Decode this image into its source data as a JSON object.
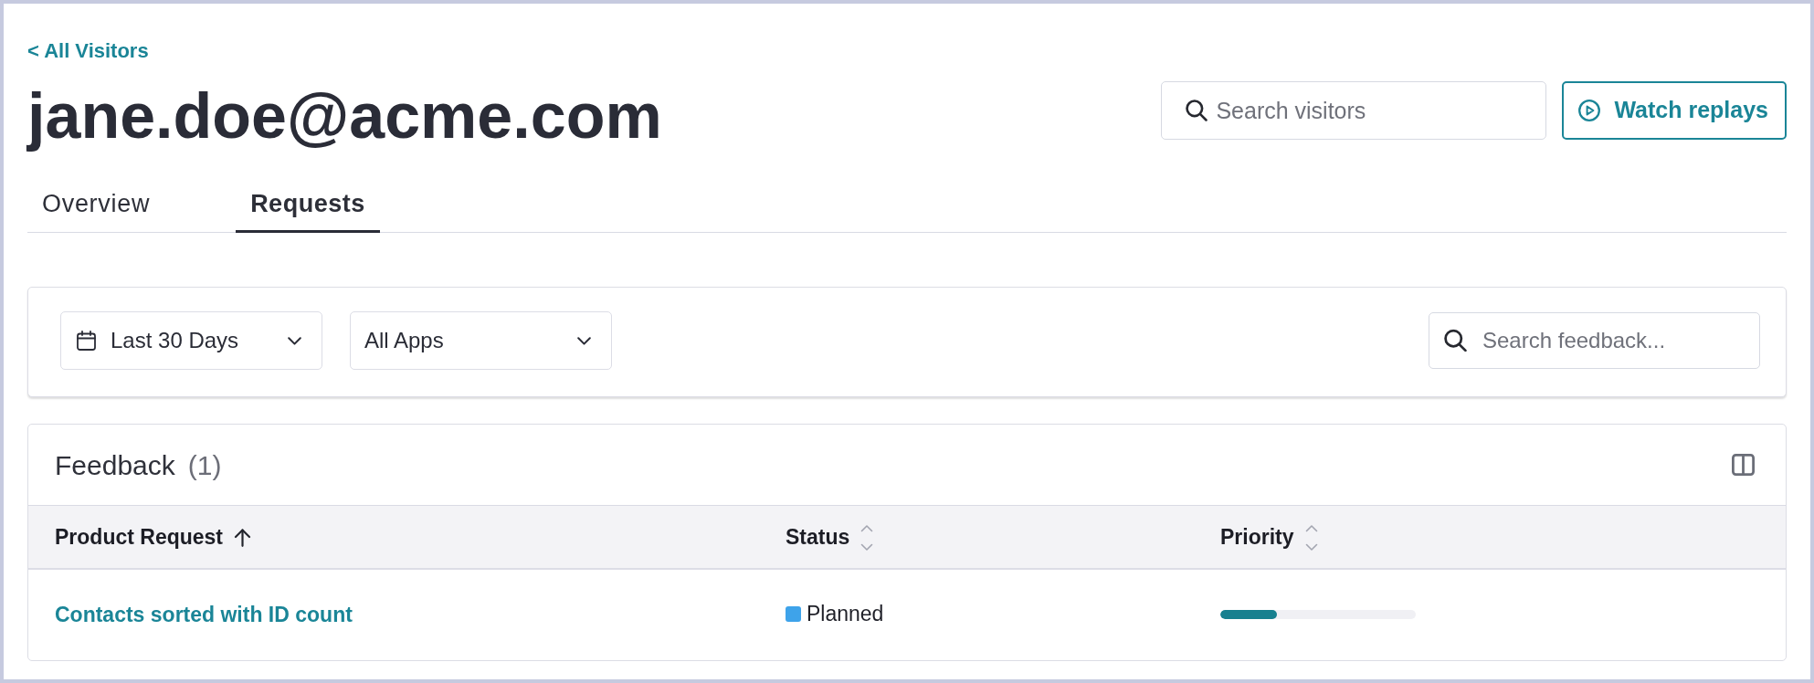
{
  "back_link": "< All Visitors",
  "title": "jane.doe@acme.com",
  "header_search": {
    "placeholder": "Search visitors"
  },
  "header_button": "Watch replays",
  "tabs": [
    {
      "label": "Overview",
      "selected": false
    },
    {
      "label": "Requests",
      "selected": true
    }
  ],
  "filters": [
    {
      "kind": "date",
      "label": "Last 30 Days"
    },
    {
      "kind": "select",
      "label": "All Apps"
    }
  ],
  "feedback_search": {
    "placeholder": "Search feedback..."
  },
  "feedback": {
    "title": "Feedback",
    "count": "(1)",
    "columns": [
      {
        "label": "Product Request",
        "sorted": true
      },
      {
        "label": "Status",
        "sorted": false
      },
      {
        "label": "Priority",
        "sorted": false
      }
    ],
    "rows": [
      {
        "request": "Contacts sorted with ID count",
        "status": {
          "label": "Planned",
          "color": "#3ea3ea"
        },
        "priority": {
          "level": 0.29
        }
      }
    ]
  }
}
